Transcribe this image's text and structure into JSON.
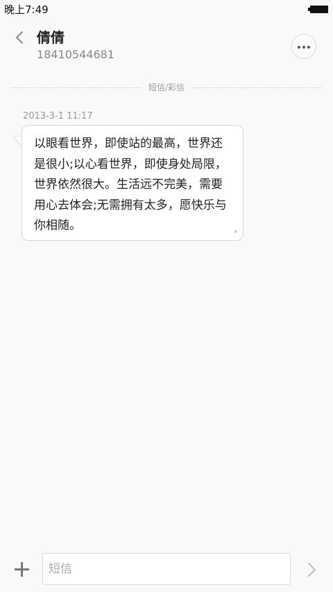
{
  "status_bar": {
    "time": "晚上7:49"
  },
  "header": {
    "contact_name": "倩倩",
    "contact_number": "18410544681",
    "back_icon": "chevron-left-icon",
    "more_icon": "more-horizontal-icon"
  },
  "thread": {
    "divider_label": "短信/彩信",
    "messages": [
      {
        "timestamp": "2013-3-1 11:17",
        "text": "以眼看世界，即使站的最高，世界还是很小;以心看世界，即使身处局限，世界依然很大。生活远不完美，需要用心去体会;无需拥有太多，愿快乐与你相随。",
        "status_mark": "*"
      }
    ]
  },
  "composer": {
    "placeholder": "短信",
    "attach_icon": "plus-icon",
    "send_icon": "chevron-right-icon"
  },
  "colors": {
    "background": "#f9f9f9",
    "bubble": "#ffffff",
    "bubble_border": "#d6d6d6",
    "accent_status": "#3ec7e0"
  }
}
